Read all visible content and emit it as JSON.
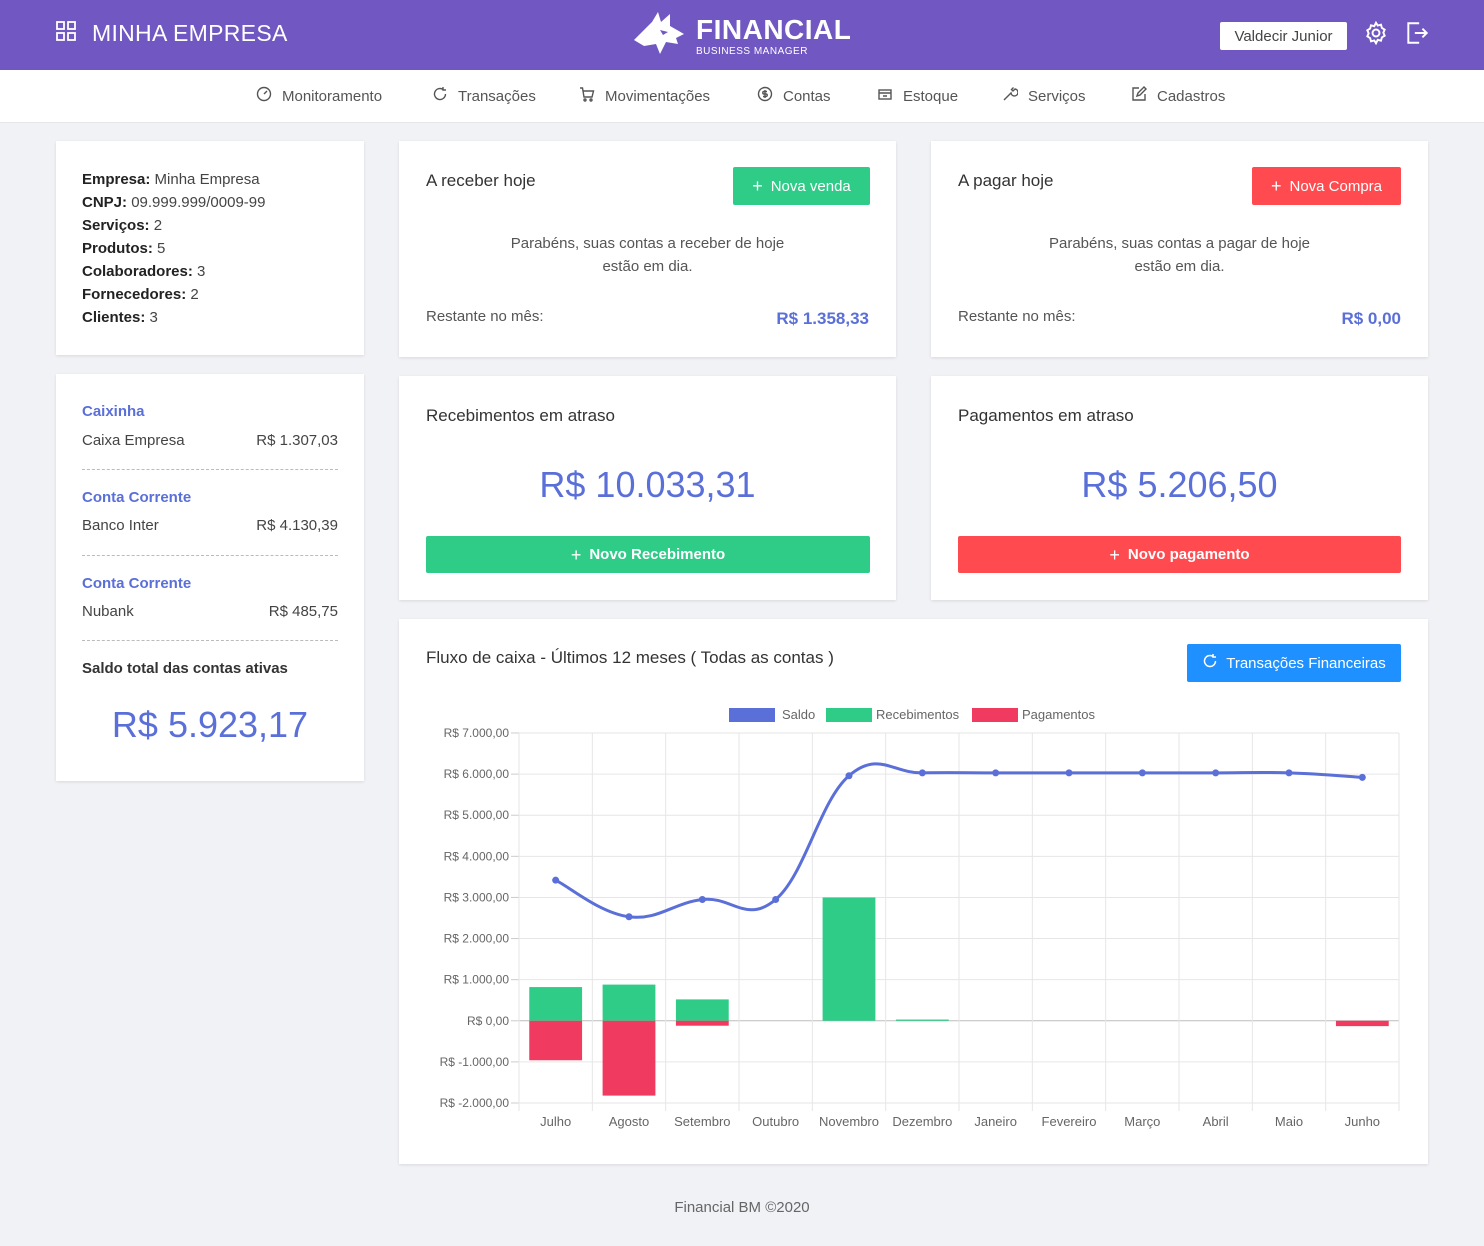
{
  "header": {
    "company": "MINHA EMPRESA",
    "logo_title": "FINANCIAL",
    "logo_subtitle": "BUSINESS MANAGER",
    "user": "Valdecir Junior"
  },
  "nav": [
    {
      "label": "Monitoramento",
      "icon": "speedometer-icon"
    },
    {
      "label": "Transações",
      "icon": "refresh-icon"
    },
    {
      "label": "Movimentações",
      "icon": "cart-icon"
    },
    {
      "label": "Contas",
      "icon": "dollar-circle-icon"
    },
    {
      "label": "Estoque",
      "icon": "box-icon"
    },
    {
      "label": "Serviços",
      "icon": "wrench-icon"
    },
    {
      "label": "Cadastros",
      "icon": "edit-icon"
    }
  ],
  "company_info": [
    {
      "label": "Empresa:",
      "value": "Minha Empresa"
    },
    {
      "label": "CNPJ:",
      "value": "09.999.999/0009-99"
    },
    {
      "label": "Serviços:",
      "value": "2"
    },
    {
      "label": "Produtos:",
      "value": "5"
    },
    {
      "label": "Colaboradores:",
      "value": "3"
    },
    {
      "label": "Fornecedores:",
      "value": "2"
    },
    {
      "label": "Clientes:",
      "value": "3"
    }
  ],
  "accounts": [
    {
      "type": "Caixinha",
      "name": "Caixa Empresa",
      "balance": "R$ 1.307,03"
    },
    {
      "type": "Conta Corrente",
      "name": "Banco Inter",
      "balance": "R$ 4.130,39"
    },
    {
      "type": "Conta Corrente",
      "name": "Nubank",
      "balance": "R$ 485,75"
    }
  ],
  "total": {
    "label": "Saldo total das contas ativas",
    "value": "R$ 5.923,17"
  },
  "receive_today": {
    "title": "A receber hoje",
    "button": "Nova venda",
    "message_line1": "Parabéns, suas contas a receber de hoje",
    "message_line2": "estão em dia.",
    "remaining_label": "Restante no mês:",
    "remaining_value": "R$ 1.358,33"
  },
  "pay_today": {
    "title": "A pagar hoje",
    "button": "Nova Compra",
    "message_line1": "Parabéns, suas contas a pagar de hoje",
    "message_line2": "estão em dia.",
    "remaining_label": "Restante no mês:",
    "remaining_value": "R$ 0,00"
  },
  "overdue_receipts": {
    "title": "Recebimentos em atraso",
    "value": "R$ 10.033,31",
    "button": "Novo Recebimento"
  },
  "overdue_payments": {
    "title": "Pagamentos em atraso",
    "value": "R$ 5.206,50",
    "button": "Novo pagamento"
  },
  "cashflow": {
    "title": "Fluxo de caixa - Últimos 12 meses ( Todas as contas )",
    "button": "Transações Financeiras"
  },
  "footer": "Financial BM ©2020",
  "colors": {
    "primary": "#7157c1",
    "green": "#2ecc87",
    "red": "#ff4b4f",
    "blue": "#1e90ff",
    "accent": "#5a6fd8",
    "pay_bar": "#f03a5f"
  },
  "chart_data": {
    "type": "bar",
    "categories": [
      "Julho",
      "Agosto",
      "Setembro",
      "Outubro",
      "Novembro",
      "Dezembro",
      "Janeiro",
      "Fevereiro",
      "Março",
      "Abril",
      "Maio",
      "Junho"
    ],
    "series": [
      {
        "name": "Saldo",
        "type": "line",
        "color": "#5a6fd8",
        "values": [
          3420,
          2530,
          2950,
          2950,
          5960,
          6030,
          6030,
          6030,
          6030,
          6030,
          6030,
          5920
        ]
      },
      {
        "name": "Recebimentos",
        "type": "bar",
        "color": "#2ecc87",
        "values": [
          820,
          880,
          520,
          0,
          3000,
          30,
          0,
          0,
          0,
          0,
          0,
          0
        ]
      },
      {
        "name": "Pagamentos",
        "type": "bar",
        "color": "#f03a5f",
        "values": [
          -960,
          -1820,
          -120,
          0,
          0,
          0,
          0,
          0,
          0,
          0,
          0,
          -130
        ]
      }
    ],
    "ylim": [
      -2000,
      7000
    ],
    "yticks": [
      "R$ 7.000,00",
      "R$ 6.000,00",
      "R$ 5.000,00",
      "R$ 4.000,00",
      "R$ 3.000,00",
      "R$ 2.000,00",
      "R$ 1.000,00",
      "R$ 0,00",
      "R$ -1.000,00",
      "R$ -2.000,00"
    ],
    "grid": true,
    "legend": "top-center"
  }
}
